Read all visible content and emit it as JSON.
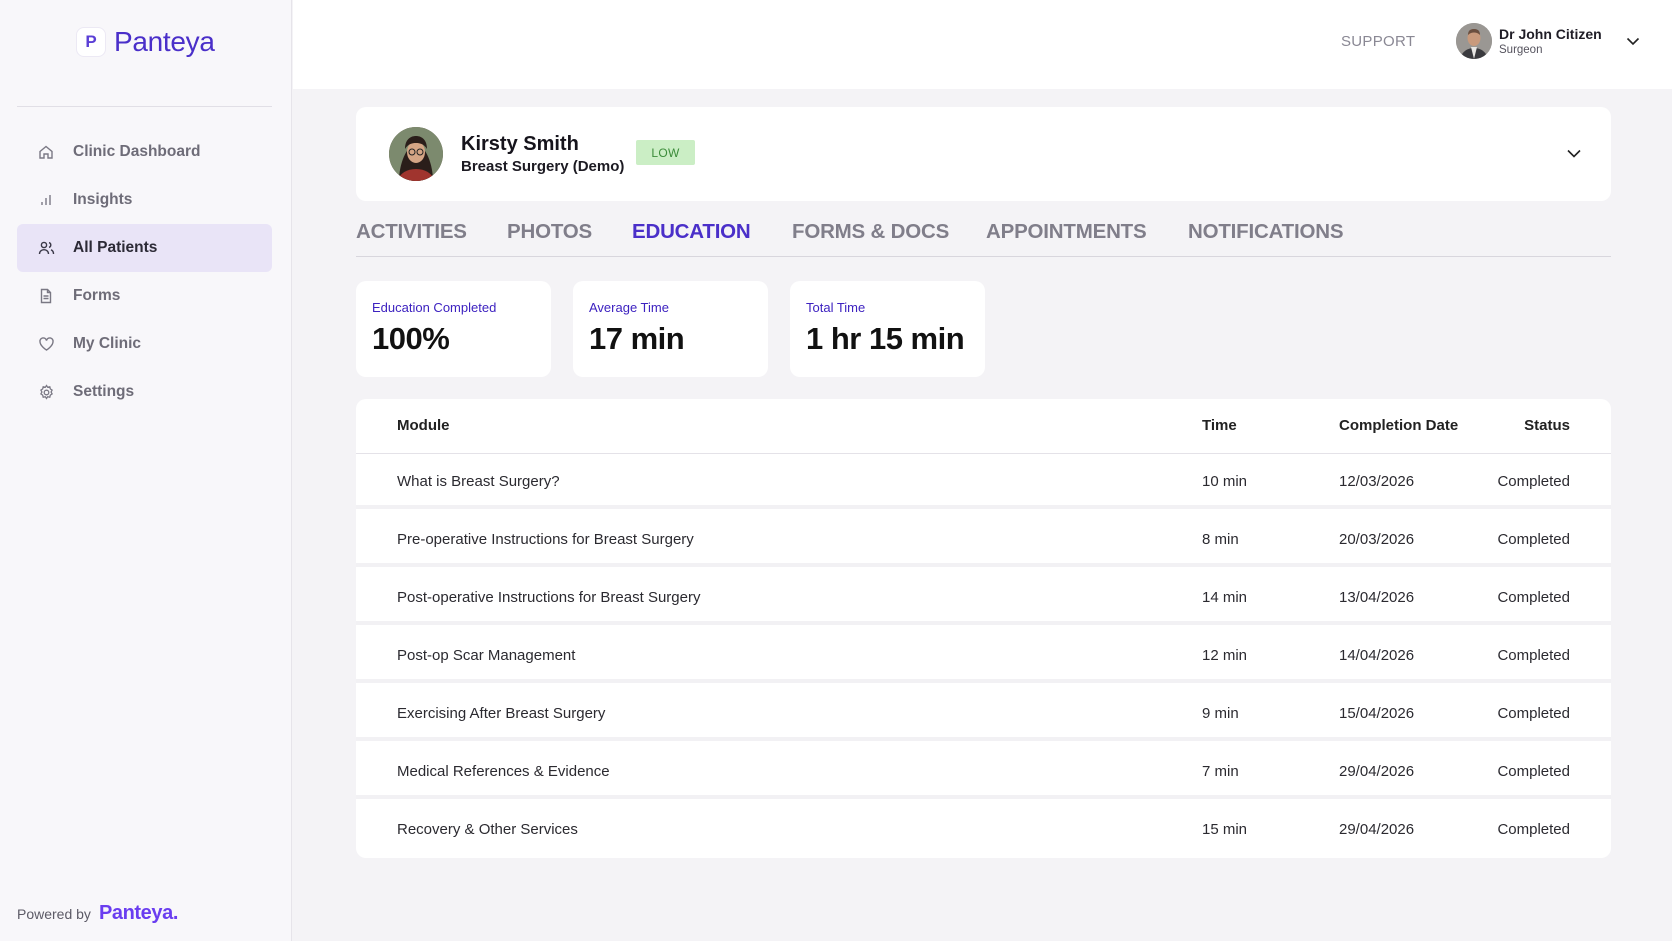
{
  "brand": {
    "logo_letter": "P",
    "name": "Panteya",
    "powered_by": "Powered by",
    "powered_brand": "Panteya."
  },
  "sidebar": {
    "items": [
      {
        "label": "Clinic Dashboard",
        "icon": "home-icon",
        "active": false
      },
      {
        "label": "Insights",
        "icon": "bar-chart-icon",
        "active": false
      },
      {
        "label": "All Patients",
        "icon": "users-icon",
        "active": true
      },
      {
        "label": "Forms",
        "icon": "document-icon",
        "active": false
      },
      {
        "label": "My Clinic",
        "icon": "heart-icon",
        "active": false
      },
      {
        "label": "Settings",
        "icon": "gear-icon",
        "active": false
      }
    ]
  },
  "header": {
    "support": "SUPPORT",
    "user": {
      "name": "Dr John Citizen",
      "role": "Surgeon"
    }
  },
  "patient": {
    "name": "Kirsty Smith",
    "procedure": "Breast Surgery (Demo)",
    "risk": "LOW"
  },
  "tabs": [
    {
      "label": "ACTIVITIES",
      "active": false
    },
    {
      "label": "PHOTOS",
      "active": false
    },
    {
      "label": "EDUCATION",
      "active": true
    },
    {
      "label": "FORMS & DOCS",
      "active": false
    },
    {
      "label": "APPOINTMENTS",
      "active": false
    },
    {
      "label": "NOTIFICATIONS",
      "active": false
    }
  ],
  "stats": [
    {
      "label": "Education Completed",
      "value": "100%"
    },
    {
      "label": "Average Time",
      "value": "17 min"
    },
    {
      "label": "Total Time",
      "value": "1 hr 15 min"
    }
  ],
  "table": {
    "headers": {
      "module": "Module",
      "time": "Time",
      "date": "Completion Date",
      "status": "Status"
    },
    "rows": [
      {
        "module": "What is Breast Surgery?",
        "time": "10 min",
        "date": "12/03/2026",
        "status": "Completed"
      },
      {
        "module": "Pre-operative Instructions for Breast Surgery",
        "time": "8 min",
        "date": "20/03/2026",
        "status": "Completed"
      },
      {
        "module": "Post-operative Instructions for Breast Surgery",
        "time": "14 min",
        "date": "13/04/2026",
        "status": "Completed"
      },
      {
        "module": "Post-op Scar Management",
        "time": "12 min",
        "date": "14/04/2026",
        "status": "Completed"
      },
      {
        "module": "Exercising After Breast Surgery",
        "time": "9 min",
        "date": "15/04/2026",
        "status": "Completed"
      },
      {
        "module": "Medical References & Evidence",
        "time": "7 min",
        "date": "29/04/2026",
        "status": "Completed"
      },
      {
        "module": "Recovery & Other Services",
        "time": "15 min",
        "date": "29/04/2026",
        "status": "Completed"
      }
    ]
  },
  "colors": {
    "accent": "#4a2fc9",
    "active_nav_bg": "#e9e4f7",
    "risk_bg": "#cbeec5",
    "risk_text": "#3c8c3a"
  }
}
